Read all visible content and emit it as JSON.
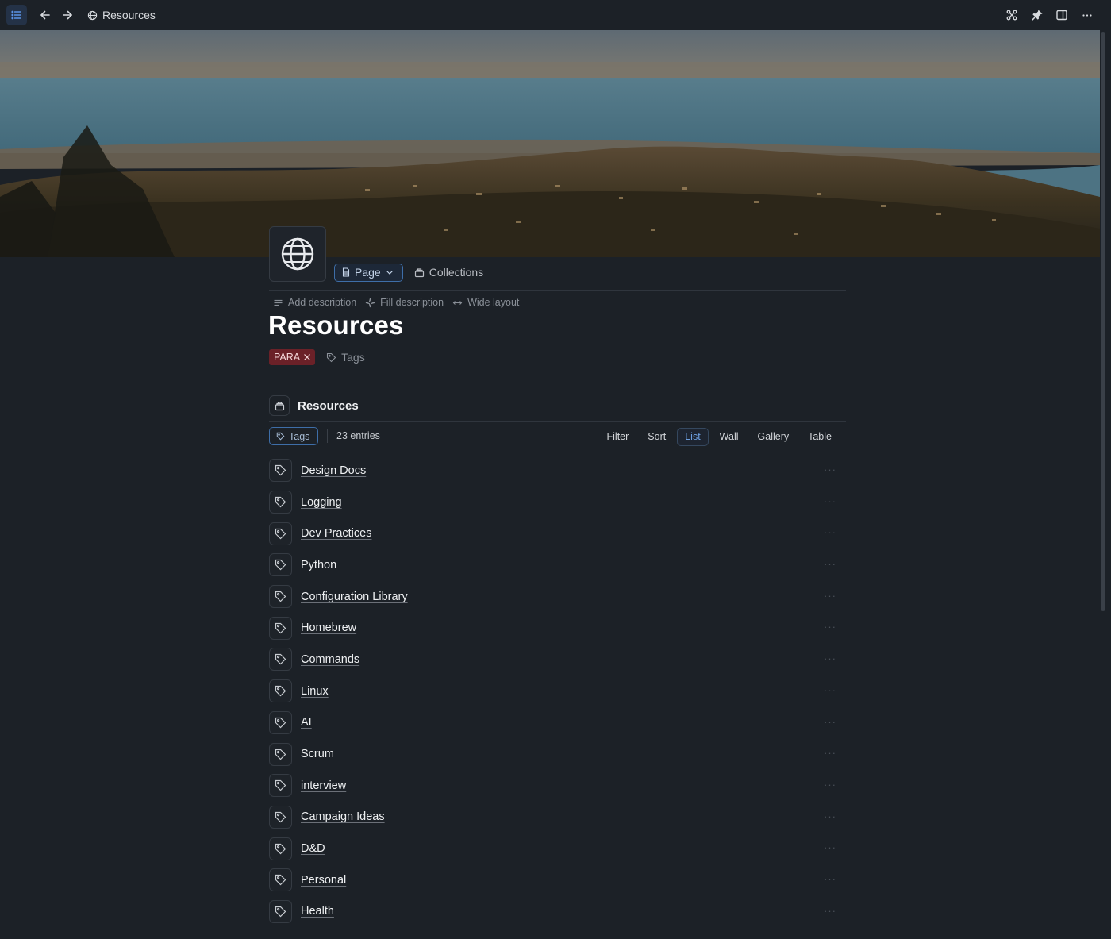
{
  "header": {
    "breadcrumb": "Resources"
  },
  "page": {
    "type_label": "Page",
    "collections_label": "Collections",
    "meta": {
      "add_description": "Add description",
      "fill_description": "Fill description",
      "wide_layout": "Wide layout"
    },
    "title": "Resources",
    "tag_chip": "PARA",
    "tags_label": "Tags"
  },
  "collection": {
    "title": "Resources",
    "filter_chip": "Tags",
    "entries": "23 entries",
    "views": [
      "Filter",
      "Sort",
      "List",
      "Wall",
      "Gallery",
      "Table"
    ],
    "active_view": "List",
    "items": [
      "Design Docs",
      "Logging",
      "Dev Practices",
      "Python",
      "Configuration Library",
      "Homebrew",
      "Commands",
      "Linux",
      "AI",
      "Scrum",
      "interview",
      "Campaign Ideas",
      "D&D",
      "Personal",
      "Health"
    ]
  },
  "colors": {
    "background": "#1c2127",
    "accent": "#3e6ea8",
    "tag_chip": "#6b2128"
  }
}
